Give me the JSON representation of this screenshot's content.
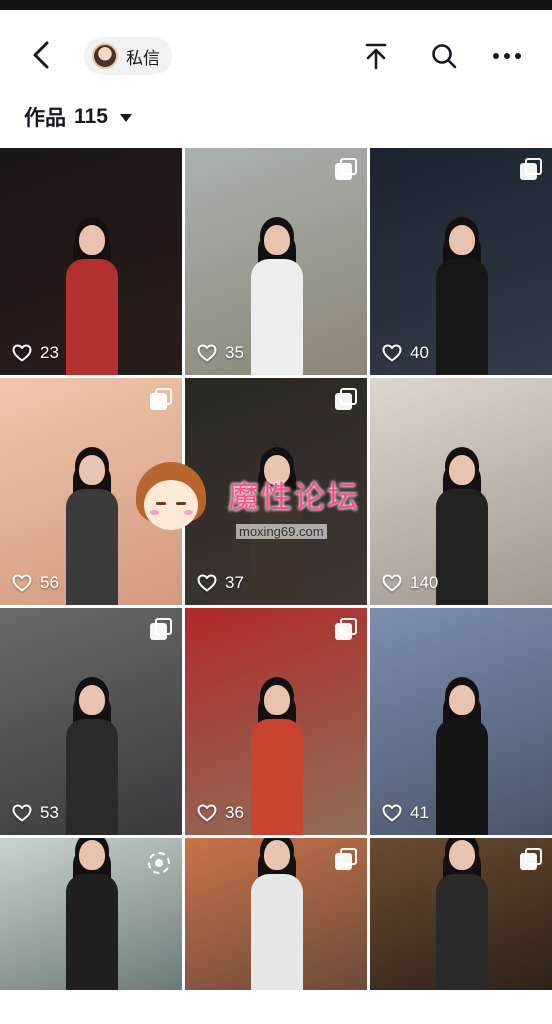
{
  "header": {
    "message_label": "私信",
    "icons": [
      "back-arrow-icon",
      "share-icon",
      "search-icon",
      "more-icon"
    ]
  },
  "works": {
    "label": "作品",
    "count": "115"
  },
  "grid": [
    {
      "likes": "23",
      "multi": false,
      "bg": [
        "#1a1616",
        "#2a1d1a"
      ],
      "outfit": "#b23030"
    },
    {
      "likes": "35",
      "multi": true,
      "bg": [
        "#a9b3ad",
        "#8d8578"
      ],
      "outfit": "#eeeeee"
    },
    {
      "likes": "40",
      "multi": true,
      "bg": [
        "#1b2230",
        "#343c4a"
      ],
      "outfit": "#181818"
    },
    {
      "likes": "56",
      "multi": true,
      "bg": [
        "#f0c6ac",
        "#d29a80"
      ],
      "outfit": "#3a3a3a"
    },
    {
      "likes": "37",
      "multi": true,
      "bg": [
        "#2a2622",
        "#3e3832"
      ],
      "outfit": "#3d352b"
    },
    {
      "likes": "140",
      "multi": false,
      "bg": [
        "#dcd6cc",
        "#9e9890"
      ],
      "outfit": "#222222"
    },
    {
      "likes": "53",
      "multi": true,
      "bg": [
        "#6a6a6e",
        "#3a3a3e"
      ],
      "outfit": "#2b2b2b"
    },
    {
      "likes": "36",
      "multi": true,
      "bg": [
        "#b02a2a",
        "#8f6f5a"
      ],
      "outfit": "#c8442e"
    },
    {
      "likes": "41",
      "multi": false,
      "bg": [
        "#7b8fb0",
        "#4a5468"
      ],
      "outfit": "#151515"
    },
    {
      "likes": "",
      "multi": false,
      "live": true,
      "bg": [
        "#c9d4cf",
        "#6c7a7a"
      ],
      "outfit": "#202020"
    },
    {
      "likes": "",
      "multi": true,
      "bg": [
        "#c9734a",
        "#6b4a3a"
      ],
      "outfit": "#e7e7e7"
    },
    {
      "likes": "",
      "multi": true,
      "bg": [
        "#6a4c30",
        "#2e2218"
      ],
      "outfit": "#2a2a2a"
    }
  ],
  "watermark": {
    "title": "魔性论坛",
    "url": "moxing69.com"
  },
  "colors": {
    "text": "#161823",
    "pill": "#f2f2f4",
    "watermark": "#ff4c8a"
  }
}
